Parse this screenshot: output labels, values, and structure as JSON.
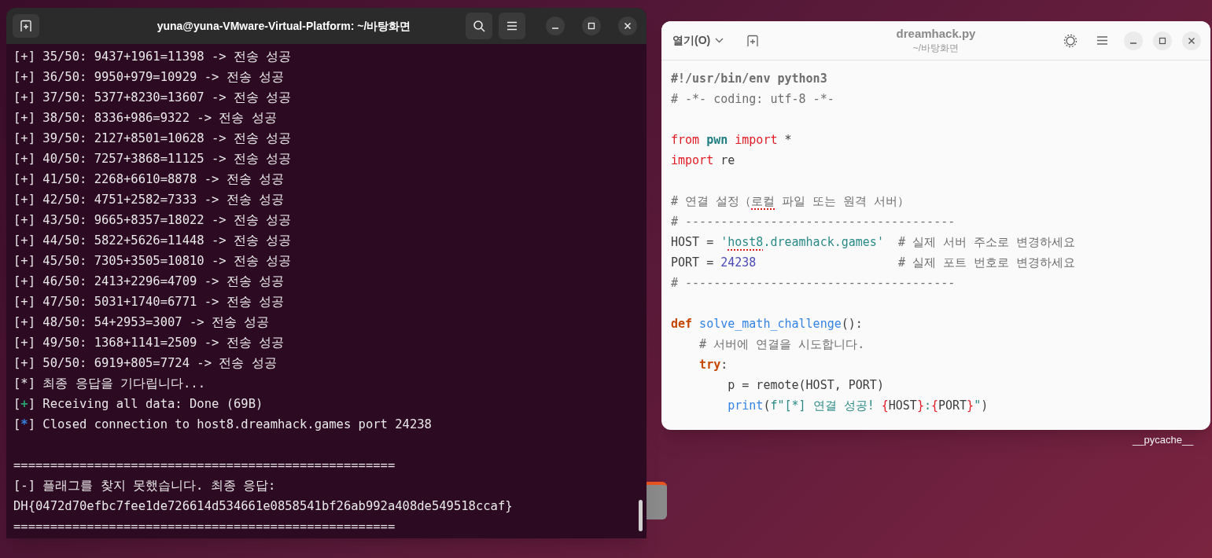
{
  "terminal": {
    "title": "yuna@yuna-VMware-Virtual-Platform: ~/바탕화면",
    "lines": [
      {
        "kind": "plain",
        "text": "[+] 35/50: 9437+1961=11398 -> 전송 성공"
      },
      {
        "kind": "plain",
        "text": "[+] 36/50: 9950+979=10929 -> 전송 성공"
      },
      {
        "kind": "plain",
        "text": "[+] 37/50: 5377+8230=13607 -> 전송 성공"
      },
      {
        "kind": "plain",
        "text": "[+] 38/50: 8336+986=9322 -> 전송 성공"
      },
      {
        "kind": "plain",
        "text": "[+] 39/50: 2127+8501=10628 -> 전송 성공"
      },
      {
        "kind": "plain",
        "text": "[+] 40/50: 7257+3868=11125 -> 전송 성공"
      },
      {
        "kind": "plain",
        "text": "[+] 41/50: 2268+6610=8878 -> 전송 성공"
      },
      {
        "kind": "plain",
        "text": "[+] 42/50: 4751+2582=7333 -> 전송 성공"
      },
      {
        "kind": "plain",
        "text": "[+] 43/50: 9665+8357=18022 -> 전송 성공"
      },
      {
        "kind": "plain",
        "text": "[+] 44/50: 5822+5626=11448 -> 전송 성공"
      },
      {
        "kind": "plain",
        "text": "[+] 45/50: 7305+3505=10810 -> 전송 성공"
      },
      {
        "kind": "plain",
        "text": "[+] 46/50: 2413+2296=4709 -> 전송 성공"
      },
      {
        "kind": "plain",
        "text": "[+] 47/50: 5031+1740=6771 -> 전송 성공"
      },
      {
        "kind": "plain",
        "text": "[+] 48/50: 54+2953=3007 -> 전송 성공"
      },
      {
        "kind": "plain",
        "text": "[+] 49/50: 1368+1141=2509 -> 전송 성공"
      },
      {
        "kind": "plain",
        "text": "[+] 50/50: 6919+805=7724 -> 전송 성공"
      },
      {
        "kind": "plain",
        "text": "[*] 최종 응답을 기다립니다..."
      },
      {
        "kind": "marked",
        "open": "[",
        "symbol": "+",
        "color": "#26a269",
        "rest": "] Receiving all data: Done (69B)"
      },
      {
        "kind": "marked",
        "open": "[",
        "symbol": "*",
        "color": "#3584e4",
        "rest": "] Closed connection to host8.dreamhack.games port 24238"
      },
      {
        "kind": "blank"
      },
      {
        "kind": "plain",
        "text": "===================================================="
      },
      {
        "kind": "plain",
        "text": "[-] 플래그를 찾지 못했습니다. 최종 응답:"
      },
      {
        "kind": "plain",
        "text": "DH{0472d70efbc7fee1de726614d534661e0858541bf26ab992a408de549518ccaf}"
      },
      {
        "kind": "plain",
        "text": "===================================================="
      }
    ]
  },
  "editor": {
    "open_menu": "열기(O)",
    "title": "dreamhack.py",
    "subtitle": "~/바탕화면",
    "lines": [
      {
        "kind": "code",
        "tokens": [
          {
            "kind": "shebang",
            "text": "#!/usr/bin/env python3"
          }
        ]
      },
      {
        "kind": "code",
        "tokens": [
          {
            "kind": "comment",
            "text": "# -*- coding: utf-8 -*-"
          }
        ]
      },
      {
        "kind": "blank"
      },
      {
        "kind": "code",
        "tokens": [
          {
            "kind": "keyword",
            "text": "from"
          },
          {
            "kind": "module",
            "text": " pwn"
          },
          {
            "kind": "keyword",
            "text": " import"
          },
          {
            "kind": "plain",
            "text": " *"
          }
        ]
      },
      {
        "kind": "code",
        "tokens": [
          {
            "kind": "keyword",
            "text": "import"
          },
          {
            "kind": "plain",
            "text": " re"
          }
        ]
      },
      {
        "kind": "blank"
      },
      {
        "kind": "code",
        "tokens": [
          {
            "kind": "comment",
            "text": "# 연결 설정（"
          },
          {
            "kind": "comment",
            "text": "로컬",
            "misspelled": true
          },
          {
            "kind": "comment",
            "text": " 파일 또는 원격 서버）"
          }
        ]
      },
      {
        "kind": "code",
        "tokens": [
          {
            "kind": "comment",
            "text": "# --------------------------------------"
          }
        ]
      },
      {
        "kind": "code",
        "tokens": [
          {
            "kind": "plain",
            "text": "HOST = "
          },
          {
            "kind": "string",
            "text": "'"
          },
          {
            "kind": "string",
            "text": "host8",
            "misspelled": true
          },
          {
            "kind": "string",
            "text": ".dreamhack.games'"
          },
          {
            "kind": "comment",
            "text": "  # 실제 서버 주소로 변경하세요"
          }
        ]
      },
      {
        "kind": "code",
        "tokens": [
          {
            "kind": "plain",
            "text": "PORT = "
          },
          {
            "kind": "number",
            "text": "24238"
          },
          {
            "kind": "comment",
            "text": "                    # 실제 포트 번호로 변경하세요"
          }
        ]
      },
      {
        "kind": "code",
        "tokens": [
          {
            "kind": "comment",
            "text": "# --------------------------------------"
          }
        ]
      },
      {
        "kind": "blank"
      },
      {
        "kind": "code",
        "tokens": [
          {
            "kind": "declaration",
            "text": "def"
          },
          {
            "kind": "function",
            "text": " solve_math_challenge"
          },
          {
            "kind": "plain",
            "text": "():"
          }
        ]
      },
      {
        "kind": "code",
        "tokens": [
          {
            "kind": "comment",
            "text": "    # 서버에 연결을 시도합니다."
          }
        ]
      },
      {
        "kind": "code",
        "tokens": [
          {
            "kind": "declaration",
            "text": "    try"
          },
          {
            "kind": "plain",
            "text": ":"
          }
        ]
      },
      {
        "kind": "code",
        "tokens": [
          {
            "kind": "plain",
            "text": "        p = remote(HOST, PORT)"
          }
        ]
      },
      {
        "kind": "code",
        "tokens": [
          {
            "kind": "function",
            "text": "        print"
          },
          {
            "kind": "plain",
            "text": "("
          },
          {
            "kind": "string",
            "text": "f\"[*] 연결 성공! "
          },
          {
            "kind": "brace",
            "text": "{"
          },
          {
            "kind": "plain",
            "text": "HOST"
          },
          {
            "kind": "brace",
            "text": "}"
          },
          {
            "kind": "string",
            "text": ":"
          },
          {
            "kind": "brace",
            "text": "{"
          },
          {
            "kind": "plain",
            "text": "PORT"
          },
          {
            "kind": "brace",
            "text": "}"
          },
          {
            "kind": "string",
            "text": "\""
          },
          {
            "kind": "plain",
            "text": ")"
          }
        ]
      }
    ]
  },
  "desktop": {
    "labels": [
      "__pycache__"
    ]
  }
}
